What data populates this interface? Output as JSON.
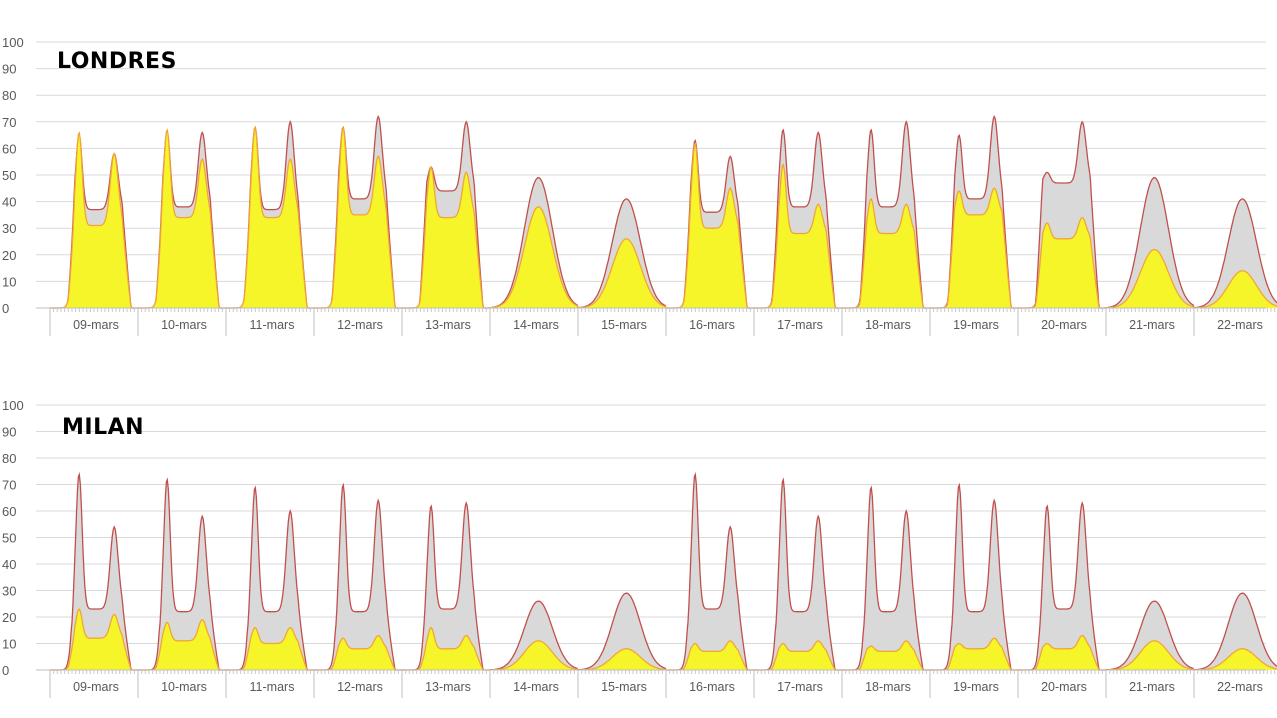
{
  "colors": {
    "background": "#ffffff",
    "grid": "#d9d9d9",
    "usual_fill": "#d9d9d9",
    "usual_line": "#c0504d",
    "current_fill": "#f5f52a",
    "current_line": "#f2a535"
  },
  "chart_data": [
    {
      "type": "area",
      "title": "LONDRES",
      "ylim": [
        0,
        100
      ],
      "y_ticks": [
        "0",
        "10",
        "20",
        "30",
        "40",
        "50",
        "60",
        "70",
        "80",
        "90",
        "100"
      ],
      "categories": [
        "09-mars",
        "10-mars",
        "11-mars",
        "12-mars",
        "13-mars",
        "14-mars",
        "15-mars",
        "16-mars",
        "17-mars",
        "18-mars",
        "19-mars",
        "20-mars",
        "21-mars",
        "22-mars"
      ],
      "grid": true,
      "series": [
        {
          "role": "usual",
          "days": [
            {
              "am": 65,
              "mid": 37,
              "pm": 58
            },
            {
              "am": 66,
              "mid": 38,
              "pm": 66
            },
            {
              "am": 68,
              "mid": 37,
              "pm": 70
            },
            {
              "am": 68,
              "mid": 41,
              "pm": 72
            },
            {
              "am": 53,
              "mid": 44,
              "pm": 70
            },
            {
              "am": 0,
              "mid": 49,
              "pm": 0
            },
            {
              "am": 0,
              "mid": 41,
              "pm": 0
            },
            {
              "am": 63,
              "mid": 36,
              "pm": 57
            },
            {
              "am": 67,
              "mid": 38,
              "pm": 66
            },
            {
              "am": 67,
              "mid": 38,
              "pm": 70
            },
            {
              "am": 65,
              "mid": 41,
              "pm": 72
            },
            {
              "am": 51,
              "mid": 47,
              "pm": 70
            },
            {
              "am": 0,
              "mid": 49,
              "pm": 0
            },
            {
              "am": 0,
              "mid": 41,
              "pm": 0
            }
          ]
        },
        {
          "role": "current",
          "days": [
            {
              "am": 66,
              "mid": 31,
              "pm": 58
            },
            {
              "am": 67,
              "mid": 34,
              "pm": 56
            },
            {
              "am": 68,
              "mid": 34,
              "pm": 56
            },
            {
              "am": 68,
              "mid": 35,
              "pm": 57
            },
            {
              "am": 53,
              "mid": 34,
              "pm": 51
            },
            {
              "am": 0,
              "mid": 38,
              "pm": 0
            },
            {
              "am": 0,
              "mid": 26,
              "pm": 0
            },
            {
              "am": 62,
              "mid": 30,
              "pm": 45
            },
            {
              "am": 54,
              "mid": 28,
              "pm": 39
            },
            {
              "am": 41,
              "mid": 28,
              "pm": 39
            },
            {
              "am": 44,
              "mid": 35,
              "pm": 45
            },
            {
              "am": 32,
              "mid": 26,
              "pm": 34
            },
            {
              "am": 0,
              "mid": 22,
              "pm": 0
            },
            {
              "am": 0,
              "mid": 14,
              "pm": 0
            }
          ]
        }
      ]
    },
    {
      "type": "area",
      "title": "MILAN",
      "ylim": [
        0,
        100
      ],
      "y_ticks": [
        "0",
        "10",
        "20",
        "30",
        "40",
        "50",
        "60",
        "70",
        "80",
        "90",
        "100"
      ],
      "categories": [
        "09-mars",
        "10-mars",
        "11-mars",
        "12-mars",
        "13-mars",
        "14-mars",
        "15-mars",
        "16-mars",
        "17-mars",
        "18-mars",
        "19-mars",
        "20-mars",
        "21-mars",
        "22-mars"
      ],
      "grid": true,
      "series": [
        {
          "role": "usual",
          "days": [
            {
              "am": 74,
              "mid": 23,
              "pm": 54
            },
            {
              "am": 72,
              "mid": 22,
              "pm": 58
            },
            {
              "am": 69,
              "mid": 22,
              "pm": 60
            },
            {
              "am": 70,
              "mid": 22,
              "pm": 64
            },
            {
              "am": 62,
              "mid": 23,
              "pm": 63
            },
            {
              "am": 0,
              "mid": 26,
              "pm": 0
            },
            {
              "am": 0,
              "mid": 29,
              "pm": 0
            },
            {
              "am": 74,
              "mid": 23,
              "pm": 54
            },
            {
              "am": 72,
              "mid": 22,
              "pm": 58
            },
            {
              "am": 69,
              "mid": 22,
              "pm": 60
            },
            {
              "am": 70,
              "mid": 22,
              "pm": 64
            },
            {
              "am": 62,
              "mid": 23,
              "pm": 63
            },
            {
              "am": 0,
              "mid": 26,
              "pm": 0
            },
            {
              "am": 0,
              "mid": 29,
              "pm": 0
            }
          ]
        },
        {
          "role": "current",
          "days": [
            {
              "am": 23,
              "mid": 12,
              "pm": 21
            },
            {
              "am": 18,
              "mid": 11,
              "pm": 19
            },
            {
              "am": 16,
              "mid": 10,
              "pm": 16
            },
            {
              "am": 12,
              "mid": 8,
              "pm": 13
            },
            {
              "am": 16,
              "mid": 8,
              "pm": 13
            },
            {
              "am": 0,
              "mid": 11,
              "pm": 0
            },
            {
              "am": 0,
              "mid": 8,
              "pm": 0
            },
            {
              "am": 10,
              "mid": 7,
              "pm": 11
            },
            {
              "am": 10,
              "mid": 7,
              "pm": 11
            },
            {
              "am": 9,
              "mid": 7,
              "pm": 11
            },
            {
              "am": 10,
              "mid": 8,
              "pm": 12
            },
            {
              "am": 10,
              "mid": 8,
              "pm": 13
            },
            {
              "am": 0,
              "mid": 11,
              "pm": 0
            },
            {
              "am": 0,
              "mid": 8,
              "pm": 0
            }
          ]
        }
      ]
    }
  ]
}
